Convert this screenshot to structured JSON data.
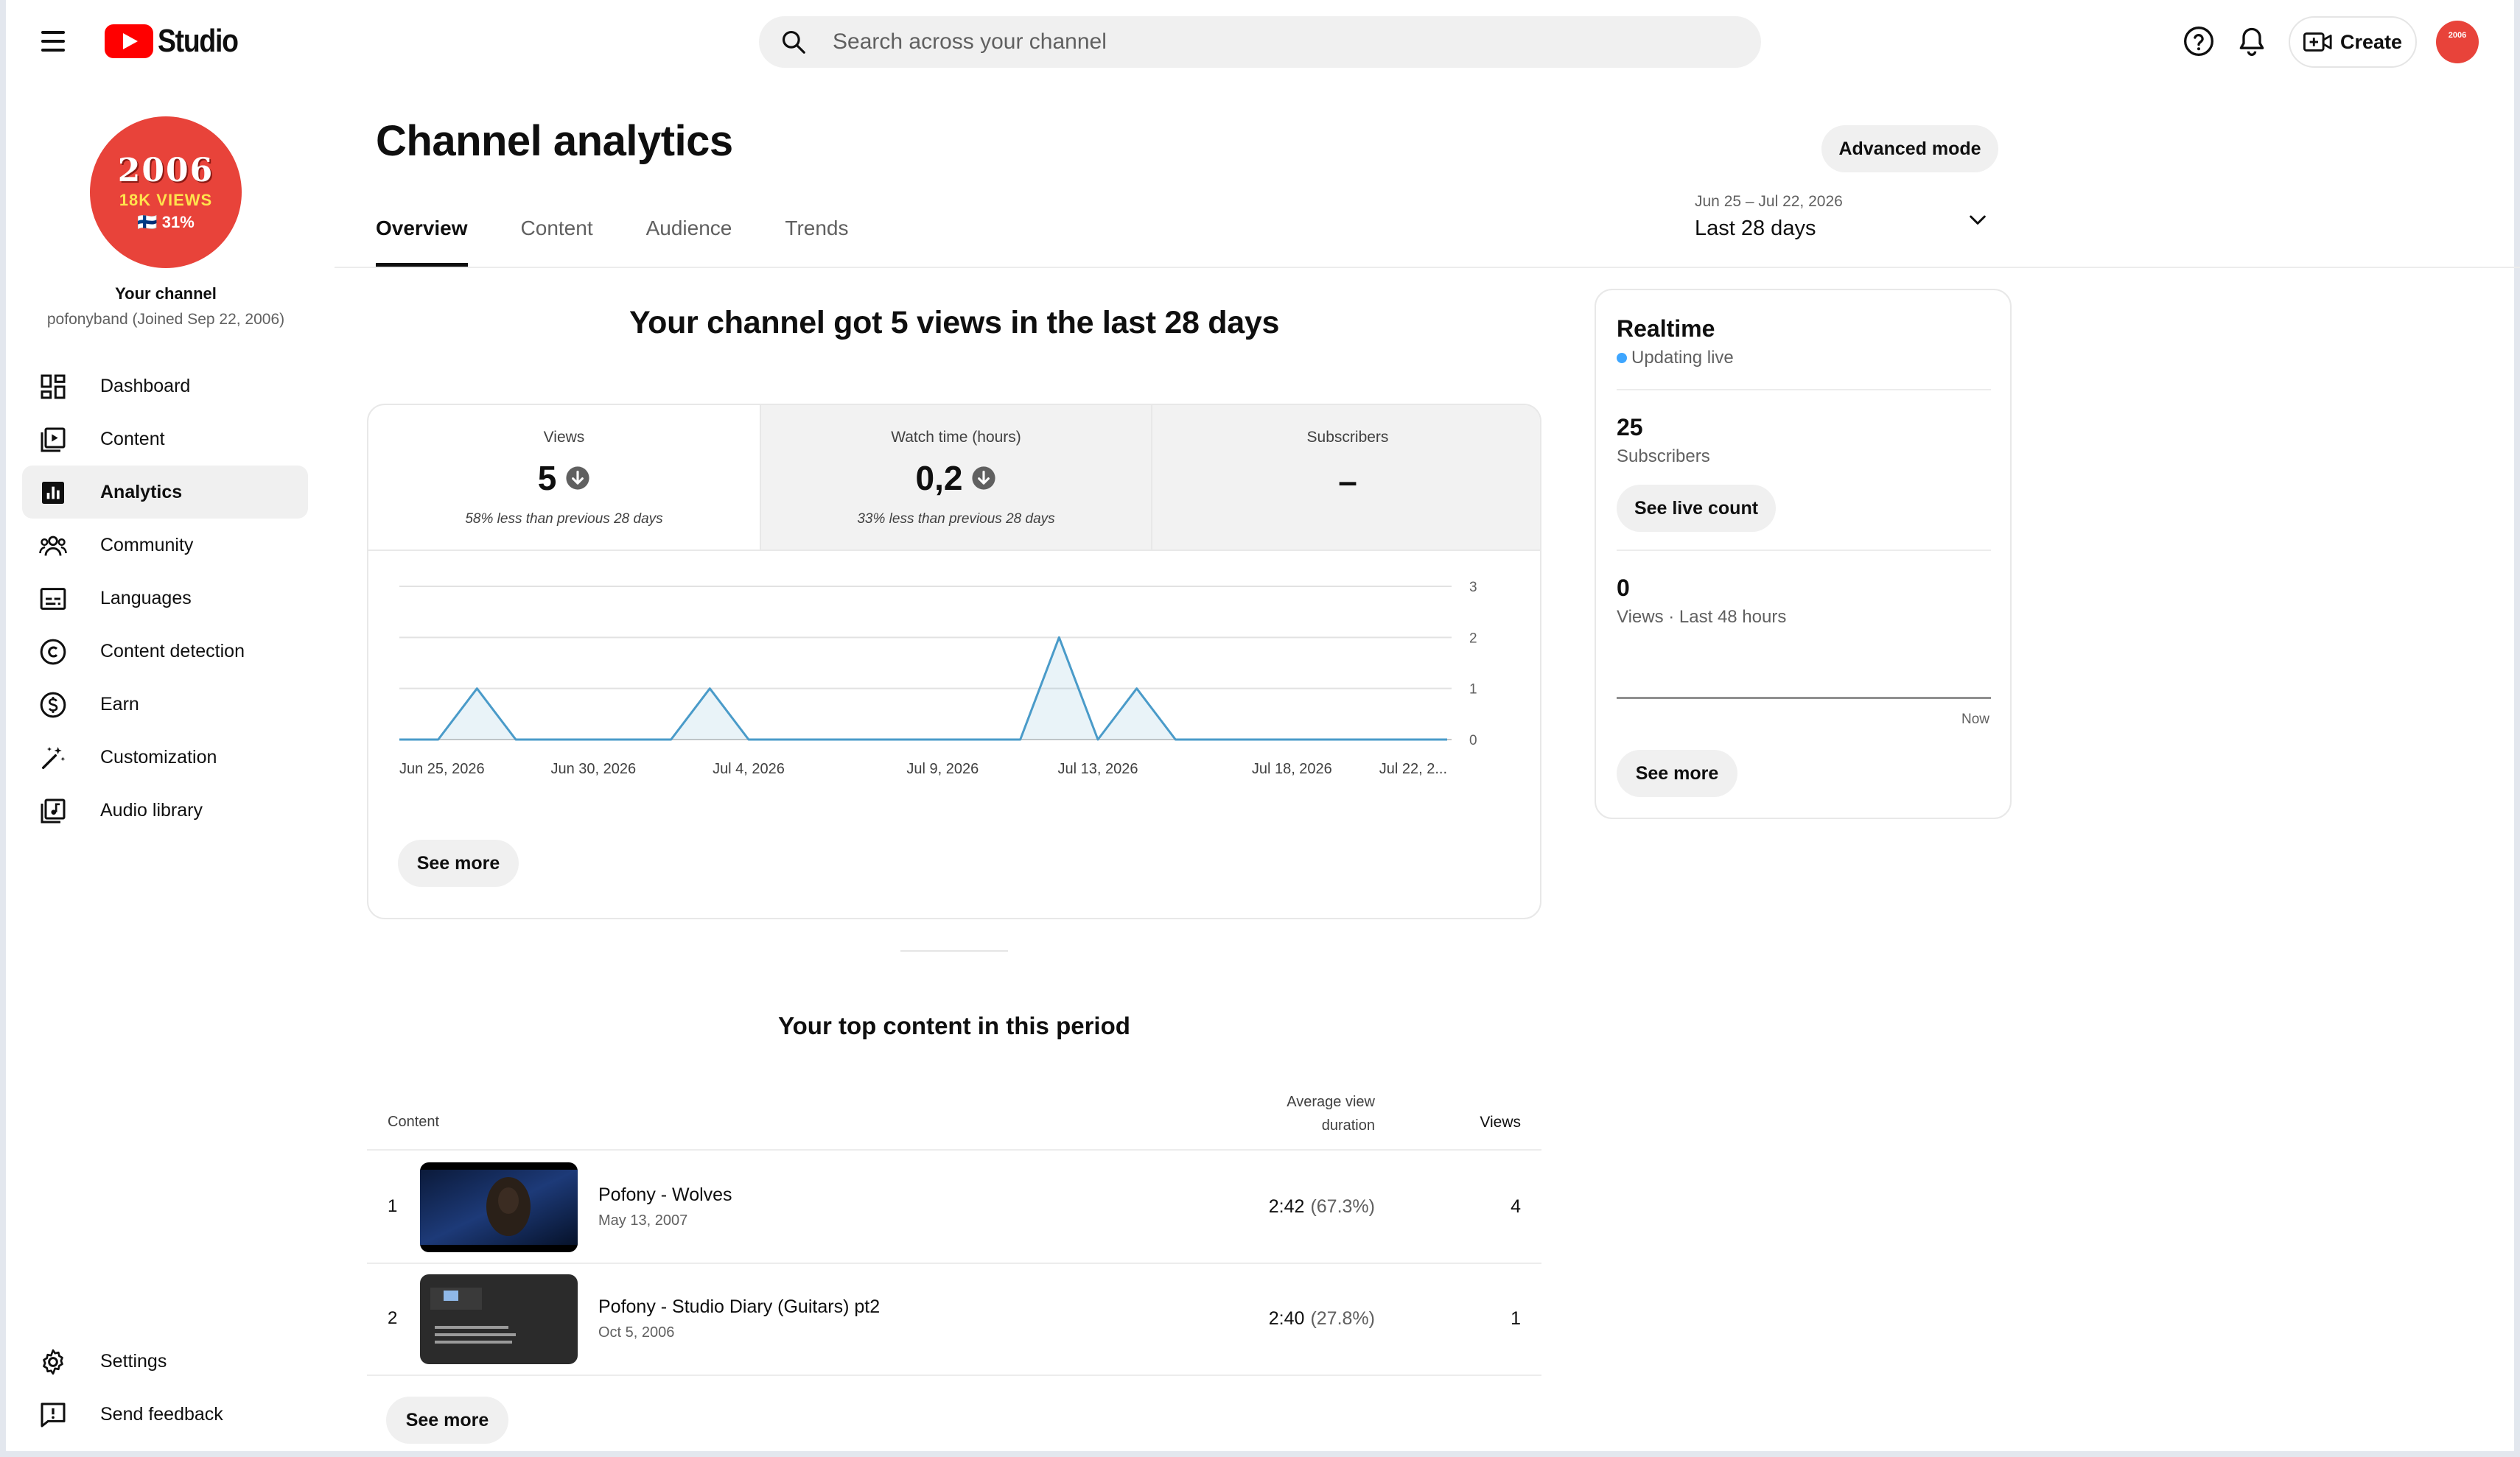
{
  "header": {
    "logo_text": "Studio",
    "search_placeholder": "Search across your channel",
    "create_label": "Create"
  },
  "channel": {
    "avatar_line1": "2006",
    "avatar_line2": "18K VIEWS",
    "avatar_line3": "🇫🇮 31%",
    "label": "Your channel",
    "subtitle": "pofonyband (Joined Sep 22, 2006)"
  },
  "sidebar": {
    "items": [
      {
        "label": "Dashboard",
        "icon": "dashboard-icon"
      },
      {
        "label": "Content",
        "icon": "content-icon"
      },
      {
        "label": "Analytics",
        "icon": "analytics-icon",
        "active": true
      },
      {
        "label": "Community",
        "icon": "community-icon"
      },
      {
        "label": "Languages",
        "icon": "languages-icon"
      },
      {
        "label": "Content detection",
        "icon": "copyright-icon"
      },
      {
        "label": "Earn",
        "icon": "dollar-icon"
      },
      {
        "label": "Customization",
        "icon": "magic-wand-icon"
      },
      {
        "label": "Audio library",
        "icon": "audio-library-icon"
      }
    ],
    "bottom": [
      {
        "label": "Settings",
        "icon": "gear-icon"
      },
      {
        "label": "Send feedback",
        "icon": "feedback-icon"
      }
    ]
  },
  "main": {
    "title": "Channel analytics",
    "advanced_mode": "Advanced mode",
    "tabs": [
      {
        "label": "Overview",
        "active": true
      },
      {
        "label": "Content"
      },
      {
        "label": "Audience"
      },
      {
        "label": "Trends"
      }
    ],
    "date_range": "Jun 25 – Jul 22, 2026",
    "date_label": "Last 28 days",
    "headline": "Your channel got 5 views in the last 28 days"
  },
  "metrics": [
    {
      "label": "Views",
      "value": "5",
      "note": "58% less than previous 28 days",
      "trend": "down"
    },
    {
      "label": "Watch time (hours)",
      "value": "0,2",
      "note": "33% less than previous 28 days",
      "trend": "down"
    },
    {
      "label": "Subscribers",
      "value": "–",
      "note": ""
    }
  ],
  "chart_data": {
    "type": "area",
    "x": [
      "Jun 25",
      "Jun 26",
      "Jun 27",
      "Jun 28",
      "Jun 29",
      "Jun 30",
      "Jul 1",
      "Jul 2",
      "Jul 3",
      "Jul 4",
      "Jul 5",
      "Jul 6",
      "Jul 7",
      "Jul 8",
      "Jul 9",
      "Jul 10",
      "Jul 11",
      "Jul 12",
      "Jul 13",
      "Jul 14",
      "Jul 15",
      "Jul 16",
      "Jul 17",
      "Jul 18",
      "Jul 19",
      "Jul 20",
      "Jul 21",
      "Jul 22"
    ],
    "values": [
      0,
      0,
      1,
      0,
      0,
      0,
      0,
      0,
      1,
      0,
      0,
      0,
      0,
      0,
      0,
      0,
      0,
      2,
      0,
      1,
      0,
      0,
      0,
      0,
      0,
      0,
      0,
      0
    ],
    "x_ticks": [
      {
        "index": 0,
        "label": "Jun 25, 2026"
      },
      {
        "index": 5,
        "label": "Jun 30, 2026"
      },
      {
        "index": 9,
        "label": "Jul 4, 2026"
      },
      {
        "index": 14,
        "label": "Jul 9, 2026"
      },
      {
        "index": 18,
        "label": "Jul 13, 2026"
      },
      {
        "index": 23,
        "label": "Jul 18, 2026"
      },
      {
        "index": 27,
        "label": "Jul 22, 2..."
      }
    ],
    "y_ticks": [
      0,
      1,
      2,
      3
    ],
    "ylim": [
      0,
      3
    ],
    "grid": true,
    "color": "#4a9bc9"
  },
  "chart_see_more": "See more",
  "realtime": {
    "title": "Realtime",
    "status": "Updating live",
    "subscribers_value": "25",
    "subscribers_label": "Subscribers",
    "see_live_count": "See live count",
    "views_value": "0",
    "views_label": "Views · Last 48 hours",
    "now_label": "Now",
    "see_more": "See more"
  },
  "top_content": {
    "title": "Your top content in this period",
    "col_content": "Content",
    "col_avd": "Average view duration",
    "col_views": "Views",
    "rows": [
      {
        "rank": "1",
        "title": "Pofony - Wolves",
        "date": "May 13, 2007",
        "avd": "2:42",
        "avd_pct": "(67.3%)",
        "views": "4"
      },
      {
        "rank": "2",
        "title": "Pofony - Studio Diary (Guitars) pt2",
        "date": "Oct 5, 2006",
        "avd": "2:40",
        "avd_pct": "(27.8%)",
        "views": "1"
      }
    ],
    "see_more": "See more"
  }
}
